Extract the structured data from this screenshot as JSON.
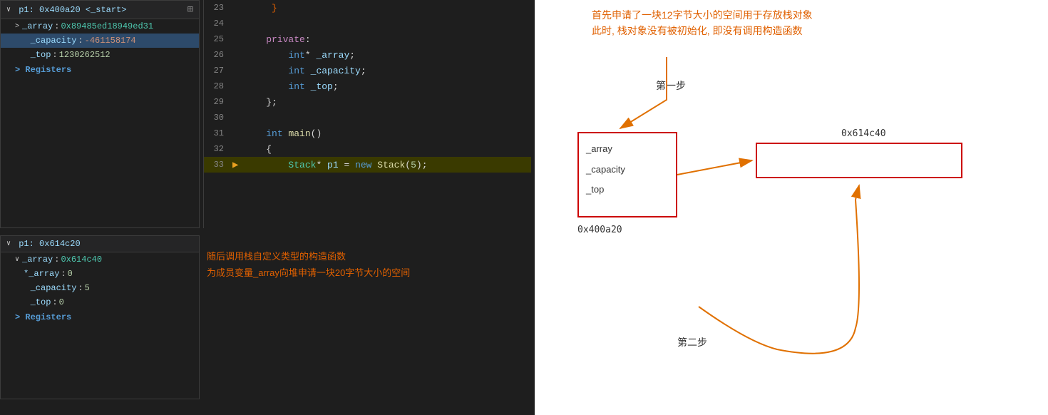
{
  "debugPanelTop": {
    "header": {
      "arrow": "∨",
      "varName": "p1: 0x400a20",
      "subLabel": "<_start>",
      "icon": "⊞"
    },
    "items": [
      {
        "indent": 1,
        "arrow": ">",
        "name": "_array",
        "colon": ":",
        "value": "0x89485ed18949ed31",
        "type": "addr"
      },
      {
        "indent": 1,
        "arrow": "",
        "name": "_capacity",
        "colon": ":",
        "value": "-461158174",
        "type": "neg",
        "highlighted": true
      },
      {
        "indent": 1,
        "arrow": "",
        "name": "_top",
        "colon": ":",
        "value": "1230262512",
        "type": "normal"
      }
    ],
    "registers": "Registers"
  },
  "debugPanelBottom": {
    "header": {
      "arrow": "∨",
      "varName": "p1: 0x614c20"
    },
    "items": [
      {
        "indent": 1,
        "arrow": "∨",
        "name": "_array",
        "colon": ":",
        "value": "0x614c40",
        "type": "addr"
      },
      {
        "indent": 2,
        "arrow": "",
        "name": "*_array",
        "colon": ":",
        "value": "0",
        "type": "normal"
      },
      {
        "indent": 1,
        "arrow": "",
        "name": "_capacity",
        "colon": ":",
        "value": "5",
        "type": "num"
      },
      {
        "indent": 1,
        "arrow": "",
        "name": "_top",
        "colon": ":",
        "value": "0",
        "type": "num"
      }
    ],
    "registers": "Registers"
  },
  "codeLines": [
    {
      "num": "23",
      "code": "",
      "active": false
    },
    {
      "num": "24",
      "code": "",
      "active": false
    },
    {
      "num": "25",
      "code": "    private:",
      "active": false
    },
    {
      "num": "26",
      "code": "        int* _array;",
      "active": false
    },
    {
      "num": "27",
      "code": "        int _capacity;",
      "active": false
    },
    {
      "num": "28",
      "code": "        int _top;",
      "active": false
    },
    {
      "num": "29",
      "code": "    };",
      "active": false
    },
    {
      "num": "30",
      "code": "",
      "active": false
    },
    {
      "num": "31",
      "code": "    int main()",
      "active": false
    },
    {
      "num": "32",
      "code": "    {",
      "active": false
    },
    {
      "num": "33",
      "code": "        Stack* p1 = new Stack(5);",
      "active": true
    }
  ],
  "annotations": {
    "topText1": "首先申请了一块12字节大小的空间用于存放栈对象",
    "topText2": "此时, 栈对象没有被初始化, 即没有调用构造函数",
    "step1Label": "第一步",
    "addr1": "0x614c40",
    "addr2": "0x400a20",
    "box1Fields": [
      "_array",
      "_capacity",
      "_top"
    ],
    "box2Content": "",
    "bottomText1": "随后调用栈自定义类型的构造函数",
    "bottomText2": "为成员变量_array向堆申请一块20字节大小的空间",
    "step2Label": "第二步"
  }
}
